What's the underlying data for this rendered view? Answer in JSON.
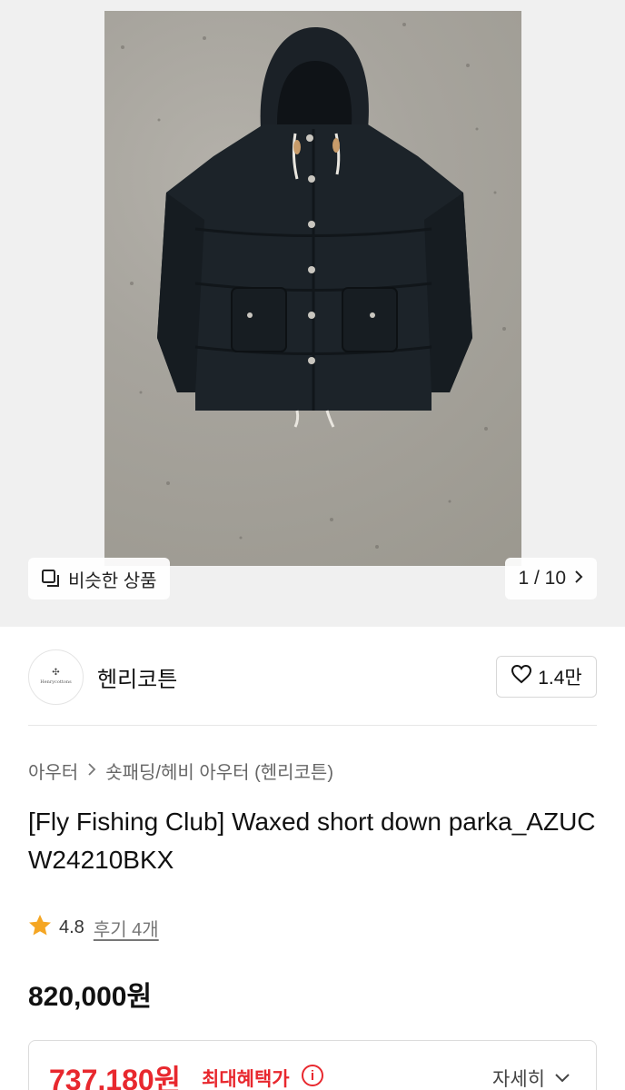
{
  "gallery": {
    "image_alt": "black down parka on concrete wall",
    "similar_label": "비슷한 상품",
    "page_counter": "1 / 10"
  },
  "brand": {
    "name": "헨리코튼",
    "logo_text": "Henrycottons",
    "likes": "1.4만"
  },
  "breadcrumb": {
    "level1": "아우터",
    "level2": "숏패딩/헤비 아우터 (헨리코튼)"
  },
  "product": {
    "title": "[Fly Fishing Club] Waxed short down parka_AZUCW24210BKX",
    "rating": "4.8",
    "reviews": "후기 4개",
    "price": "820,000원"
  },
  "benefit": {
    "price": "737,180원",
    "label": "최대혜택가",
    "detail": "자세히"
  },
  "colors": {
    "accent_red": "#e8282e",
    "star": "#f5a623"
  },
  "icons": [
    "similar-products-icon",
    "chevron-right-icon",
    "heart-icon",
    "star-icon",
    "info-icon",
    "chevron-down-icon"
  ]
}
